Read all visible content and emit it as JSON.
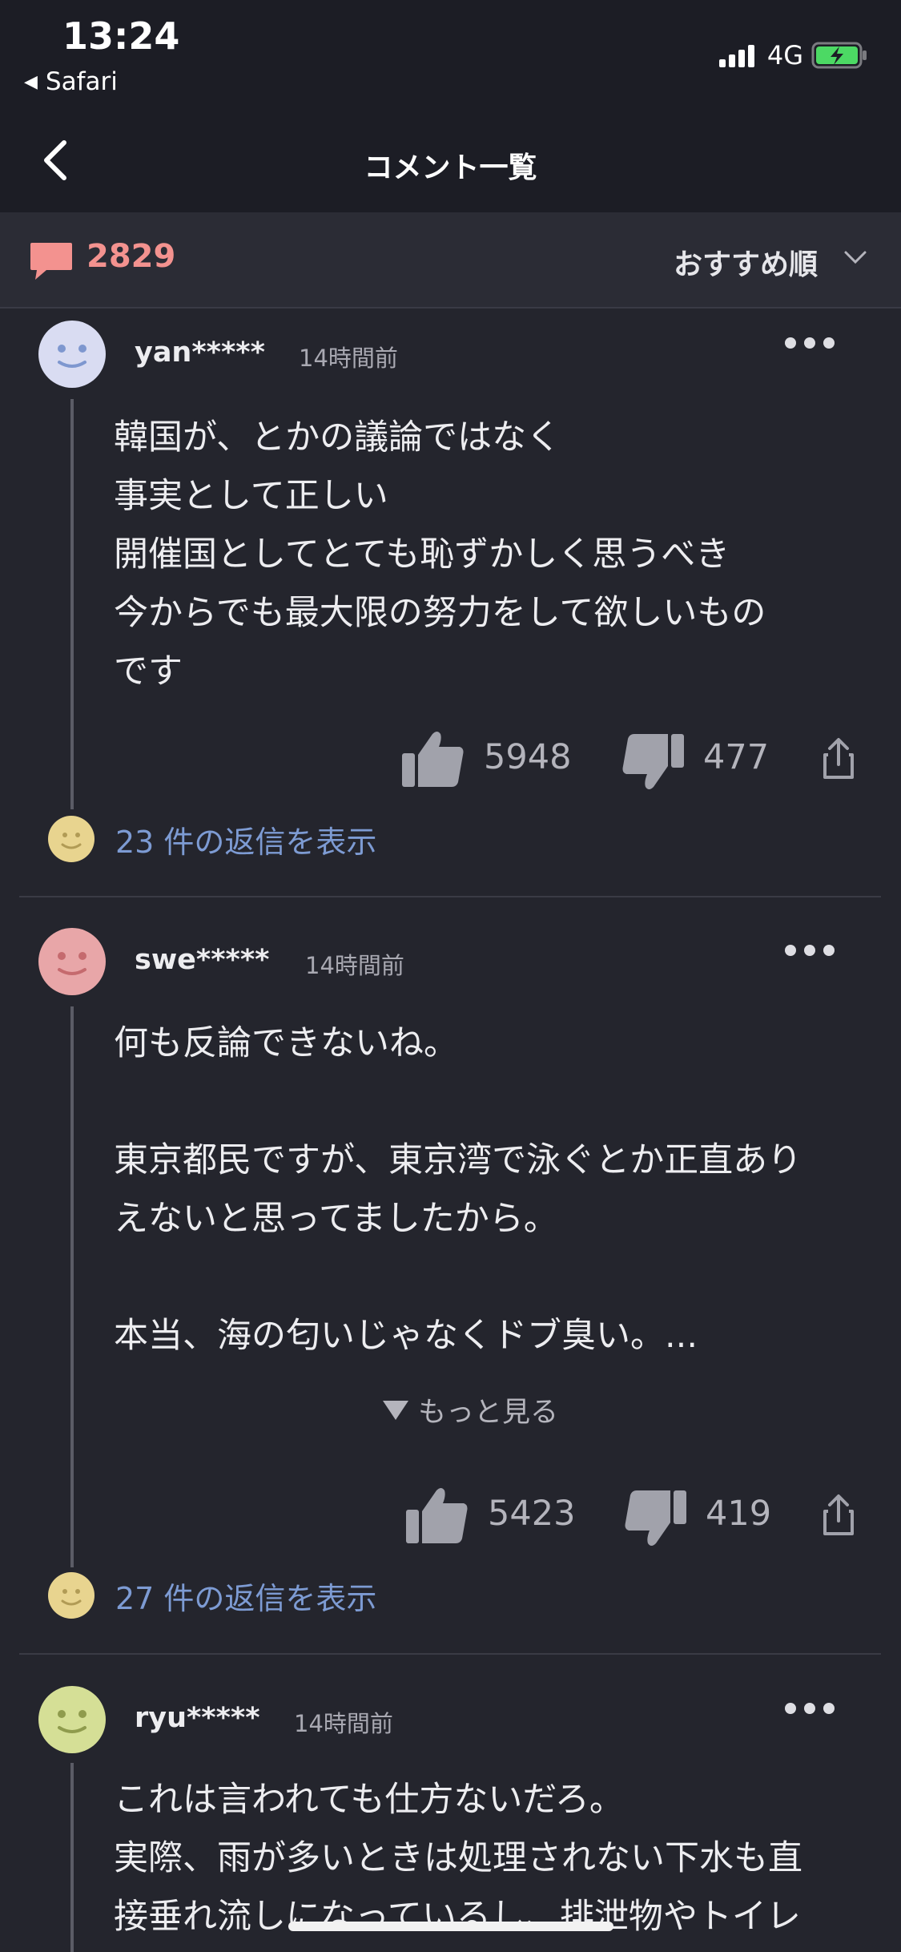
{
  "status_bar": {
    "time": "13:24",
    "back_app": "Safari",
    "network": "4G"
  },
  "nav": {
    "title": "コメント一覧"
  },
  "summary": {
    "comment_count": "2829",
    "sort_label": "おすすめ順"
  },
  "comments": [
    {
      "username": "yan*****",
      "timestamp": "14時間前",
      "body": "韓国が、とかの議論ではなく\n事実として正しい\n開催国としてとても恥ずかしく思うべき\n今からでも最大限の努力をして欲しいもの\nです",
      "likes": "5948",
      "dislikes": "477",
      "replies": "23 件の返信を表示",
      "avatar_color": "#d9dcf2"
    },
    {
      "username": "swe*****",
      "timestamp": "14時間前",
      "body": "何も反論できないね。\n\n東京都民ですが、東京湾で泳ぐとか正直あり\nえないと思ってましたから。\n\n本当、海の匂いじゃなくドブ臭い。...",
      "see_more": "もっと見る",
      "likes": "5423",
      "dislikes": "419",
      "replies": "27 件の返信を表示",
      "avatar_color": "#e8a6a8"
    },
    {
      "username": "ryu*****",
      "timestamp": "14時間前",
      "body": "これは言われても仕方ないだろ。\n実際、雨が多いときは処理されない下水も直\n接垂れ流しになっているし、排泄物やトイレ",
      "avatar_color": "#d5df96"
    }
  ],
  "colors": {
    "accent_count": "#f3928f",
    "reply_link": "#7d9bd3",
    "background": "#24252d"
  }
}
